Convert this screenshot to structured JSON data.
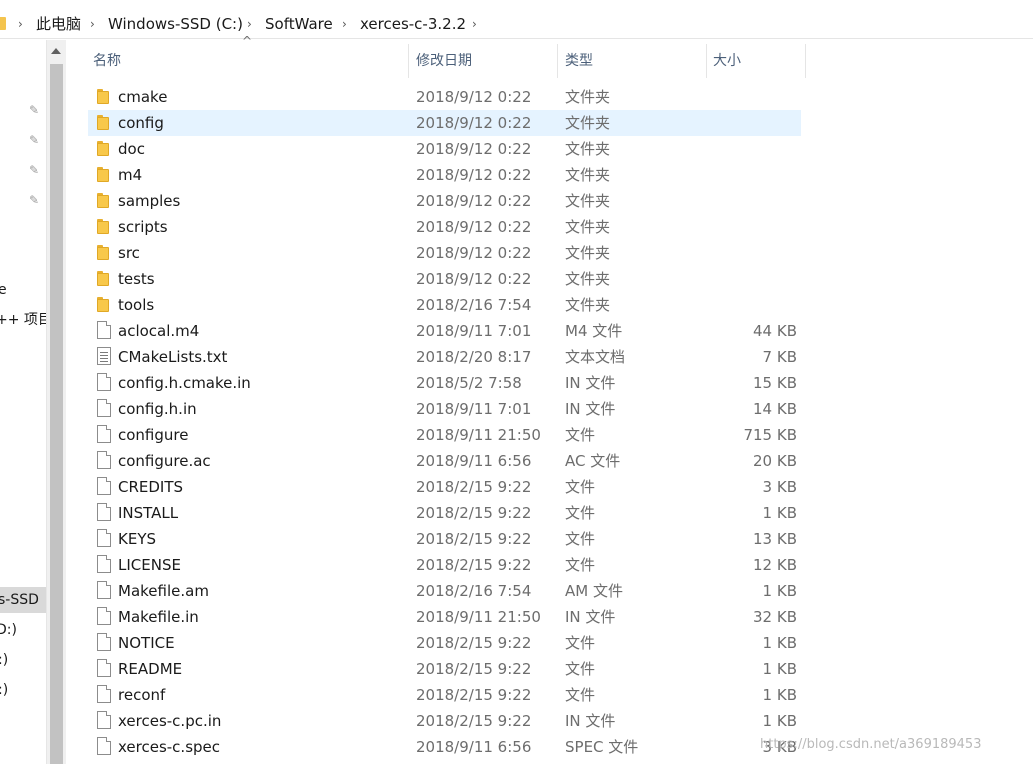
{
  "breadcrumb": {
    "items": [
      "此电脑",
      "Windows-SSD (C:)",
      "SoftWare",
      "xerces-c-3.2.2"
    ]
  },
  "nav": {
    "partial_labels": [
      "e",
      "++ 项目",
      "s-SSD",
      "D:)",
      ":)",
      ":)"
    ]
  },
  "columns": {
    "name": "名称",
    "date": "修改日期",
    "type": "类型",
    "size": "大小"
  },
  "files": [
    {
      "name": "cmake",
      "date": "2018/9/12 0:22",
      "type": "文件夹",
      "size": "",
      "icon": "folder-icon"
    },
    {
      "name": "config",
      "date": "2018/9/12 0:22",
      "type": "文件夹",
      "size": "",
      "icon": "folder-icon",
      "selected": true
    },
    {
      "name": "doc",
      "date": "2018/9/12 0:22",
      "type": "文件夹",
      "size": "",
      "icon": "folder-icon"
    },
    {
      "name": "m4",
      "date": "2018/9/12 0:22",
      "type": "文件夹",
      "size": "",
      "icon": "folder-icon"
    },
    {
      "name": "samples",
      "date": "2018/9/12 0:22",
      "type": "文件夹",
      "size": "",
      "icon": "folder-icon"
    },
    {
      "name": "scripts",
      "date": "2018/9/12 0:22",
      "type": "文件夹",
      "size": "",
      "icon": "folder-icon"
    },
    {
      "name": "src",
      "date": "2018/9/12 0:22",
      "type": "文件夹",
      "size": "",
      "icon": "folder-icon"
    },
    {
      "name": "tests",
      "date": "2018/9/12 0:22",
      "type": "文件夹",
      "size": "",
      "icon": "folder-icon"
    },
    {
      "name": "tools",
      "date": "2018/2/16 7:54",
      "type": "文件夹",
      "size": "",
      "icon": "folder-icon"
    },
    {
      "name": "aclocal.m4",
      "date": "2018/9/11 7:01",
      "type": "M4 文件",
      "size": "44 KB",
      "icon": "file-icon"
    },
    {
      "name": "CMakeLists.txt",
      "date": "2018/2/20 8:17",
      "type": "文本文档",
      "size": "7 KB",
      "icon": "text-file-icon"
    },
    {
      "name": "config.h.cmake.in",
      "date": "2018/5/2 7:58",
      "type": "IN 文件",
      "size": "15 KB",
      "icon": "file-icon"
    },
    {
      "name": "config.h.in",
      "date": "2018/9/11 7:01",
      "type": "IN 文件",
      "size": "14 KB",
      "icon": "file-icon"
    },
    {
      "name": "configure",
      "date": "2018/9/11 21:50",
      "type": "文件",
      "size": "715 KB",
      "icon": "file-icon"
    },
    {
      "name": "configure.ac",
      "date": "2018/9/11 6:56",
      "type": "AC 文件",
      "size": "20 KB",
      "icon": "file-icon"
    },
    {
      "name": "CREDITS",
      "date": "2018/2/15 9:22",
      "type": "文件",
      "size": "3 KB",
      "icon": "file-icon"
    },
    {
      "name": "INSTALL",
      "date": "2018/2/15 9:22",
      "type": "文件",
      "size": "1 KB",
      "icon": "file-icon"
    },
    {
      "name": "KEYS",
      "date": "2018/2/15 9:22",
      "type": "文件",
      "size": "13 KB",
      "icon": "file-icon"
    },
    {
      "name": "LICENSE",
      "date": "2018/2/15 9:22",
      "type": "文件",
      "size": "12 KB",
      "icon": "file-icon"
    },
    {
      "name": "Makefile.am",
      "date": "2018/2/16 7:54",
      "type": "AM 文件",
      "size": "1 KB",
      "icon": "file-icon"
    },
    {
      "name": "Makefile.in",
      "date": "2018/9/11 21:50",
      "type": "IN 文件",
      "size": "32 KB",
      "icon": "file-icon"
    },
    {
      "name": "NOTICE",
      "date": "2018/2/15 9:22",
      "type": "文件",
      "size": "1 KB",
      "icon": "file-icon"
    },
    {
      "name": "README",
      "date": "2018/2/15 9:22",
      "type": "文件",
      "size": "1 KB",
      "icon": "file-icon"
    },
    {
      "name": "reconf",
      "date": "2018/2/15 9:22",
      "type": "文件",
      "size": "1 KB",
      "icon": "file-icon"
    },
    {
      "name": "xerces-c.pc.in",
      "date": "2018/2/15 9:22",
      "type": "IN 文件",
      "size": "1 KB",
      "icon": "file-icon"
    },
    {
      "name": "xerces-c.spec",
      "date": "2018/9/11 6:56",
      "type": "SPEC 文件",
      "size": "3 KB",
      "icon": "file-icon"
    }
  ],
  "watermark": "https://blog.csdn.net/a369189453"
}
